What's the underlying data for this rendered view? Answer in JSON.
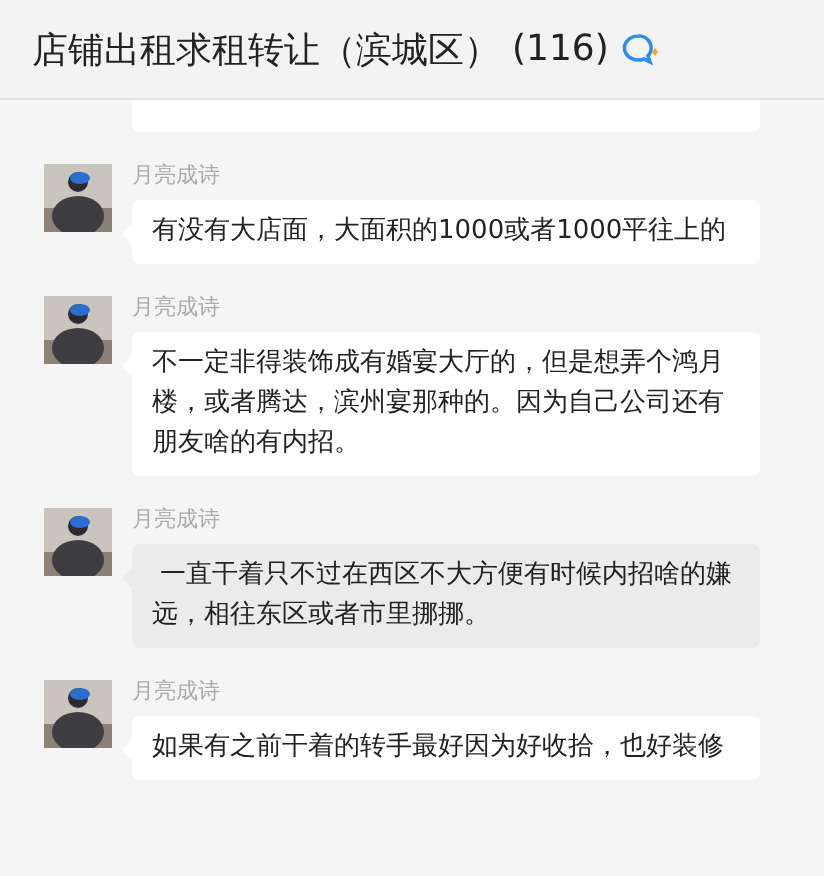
{
  "chat": {
    "title": "店铺出租求租转让（滨城区）",
    "member_count": "(116)"
  },
  "messages": [
    {
      "sender": "月亮成诗",
      "text": "有没有大店面，大面积的1000或者1000平往上的",
      "highlighted": false
    },
    {
      "sender": "月亮成诗",
      "text": "不一定非得装饰成有婚宴大厅的，但是想弄个鸿月楼，或者腾达，滨州宴那种的。因为自己公司还有朋友啥的有内招。",
      "highlighted": false
    },
    {
      "sender": "月亮成诗",
      "text": " 一直干着只不过在西区不大方便有时候内招啥的嫌远，相往东区或者市里挪挪。",
      "highlighted": true
    },
    {
      "sender": "月亮成诗",
      "text": "如果有之前干着的转手最好因为好收拾，也好装修",
      "highlighted": false
    }
  ]
}
